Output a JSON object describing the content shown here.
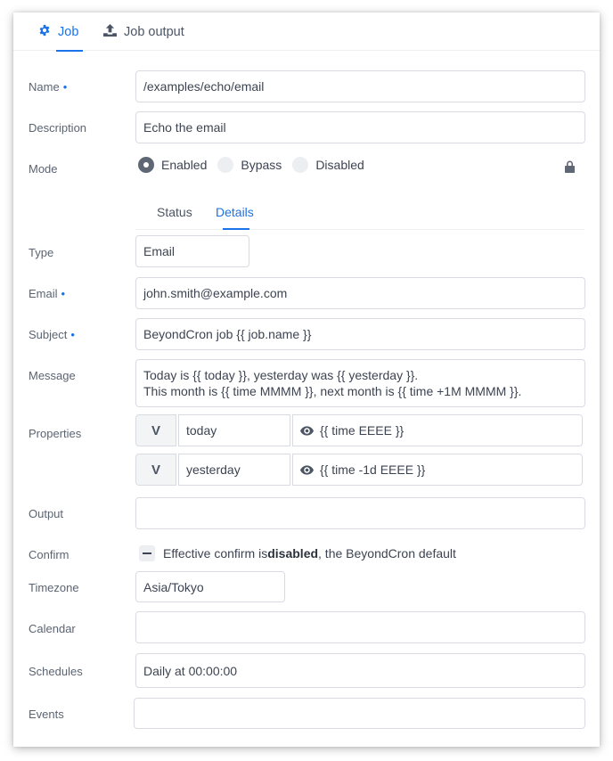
{
  "tabs": [
    {
      "label": "Job",
      "icon": "gear-icon",
      "active": true
    },
    {
      "label": "Job output",
      "icon": "upload-icon",
      "active": false
    }
  ],
  "form": {
    "name": {
      "label": "Name",
      "required_marker": "•",
      "value": "/examples/echo/email"
    },
    "description": {
      "label": "Description",
      "value": "Echo the email"
    },
    "mode": {
      "label": "Mode",
      "options": [
        "Enabled",
        "Bypass",
        "Disabled"
      ],
      "selected": "Enabled",
      "lock_icon": "lock-icon"
    },
    "sub_tabs": [
      {
        "label": "Status",
        "active": false
      },
      {
        "label": "Details",
        "active": true
      }
    ],
    "type": {
      "label": "Type",
      "value": "Email"
    },
    "email": {
      "label": "Email",
      "required_marker": "•",
      "value": "john.smith@example.com"
    },
    "subject": {
      "label": "Subject",
      "required_marker": "•",
      "value": "BeyondCron job {{ job.name }}"
    },
    "message": {
      "label": "Message",
      "lines": [
        "Today is {{ today }}, yesterday was {{ yesterday }}.",
        "This month is {{ time MMMM }}, next month is {{ time +1M MMMM }}."
      ]
    },
    "properties": {
      "label": "Properties",
      "items": [
        {
          "type": "V",
          "name": "today",
          "value": "{{ time EEEE }}"
        },
        {
          "type": "V",
          "name": "yesterday",
          "value": "{{ time -1d EEEE }}"
        }
      ]
    },
    "output": {
      "label": "Output",
      "value": ""
    },
    "confirm": {
      "label": "Confirm",
      "text_before": "Effective confirm is ",
      "text_bold": "disabled",
      "text_after": ", the BeyondCron default"
    },
    "timezone": {
      "label": "Timezone",
      "value": "Asia/Tokyo"
    },
    "calendar": {
      "label": "Calendar",
      "value": ""
    },
    "schedules": {
      "label": "Schedules",
      "value": "Daily at 00:00:00"
    },
    "events": {
      "label": "Events",
      "value": ""
    }
  },
  "colors": {
    "accent": "#1a73e8",
    "text": "#3d4451",
    "label": "#5b6472",
    "border": "#d8dce2"
  }
}
